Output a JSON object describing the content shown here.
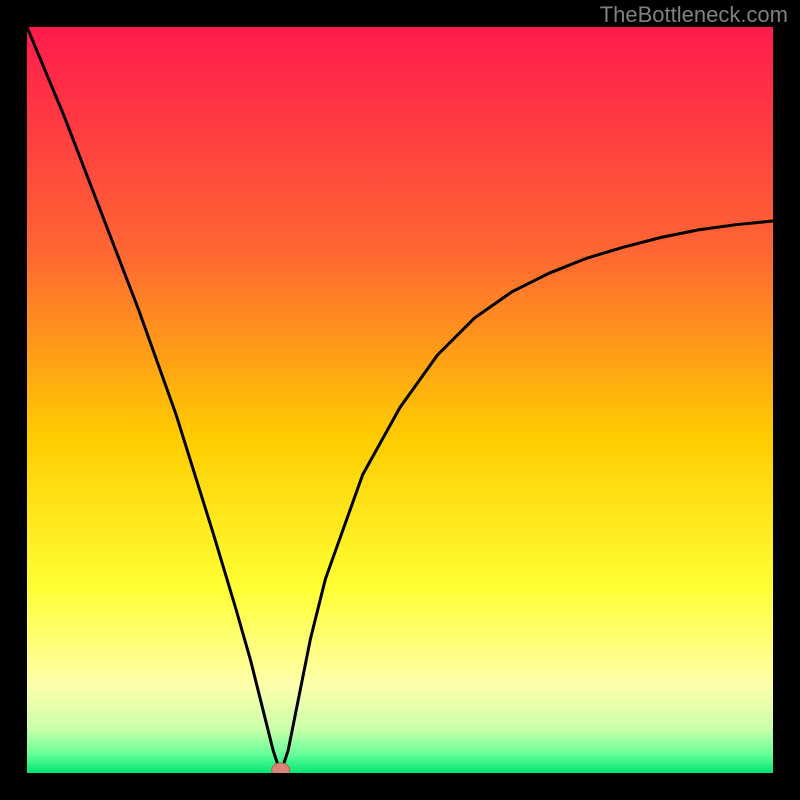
{
  "watermark": "TheBottleneck.com",
  "chart_data": {
    "type": "line",
    "title": "",
    "xlabel": "",
    "ylabel": "",
    "xlim": [
      0,
      100
    ],
    "ylim": [
      0,
      100
    ],
    "minimum_x": 34,
    "marker": {
      "x": 34,
      "y": 0
    },
    "series": [
      {
        "name": "curve",
        "x": [
          0,
          5,
          10,
          15,
          20,
          25,
          28,
          30,
          32,
          33,
          34,
          35,
          36,
          38,
          40,
          45,
          50,
          55,
          60,
          65,
          70,
          75,
          80,
          85,
          90,
          95,
          100
        ],
        "y": [
          100,
          88,
          75,
          62,
          48,
          32,
          22,
          15,
          7,
          3,
          0,
          3,
          8,
          18,
          26,
          40,
          49,
          56,
          61,
          64.5,
          67,
          69,
          70.5,
          71.8,
          72.8,
          73.5,
          74
        ]
      }
    ],
    "gradient_stops": [
      {
        "pos": 0,
        "color": "#ff1a4d"
      },
      {
        "pos": 30,
        "color": "#ff6633"
      },
      {
        "pos": 55,
        "color": "#ffcc00"
      },
      {
        "pos": 75,
        "color": "#ffff33"
      },
      {
        "pos": 88,
        "color": "#ffffaa"
      },
      {
        "pos": 94,
        "color": "#ccffaa"
      },
      {
        "pos": 97.5,
        "color": "#66ff99"
      },
      {
        "pos": 100,
        "color": "#00e673"
      }
    ],
    "colors": {
      "background": "#000000",
      "curve": "#000000",
      "marker_fill": "#d9857a",
      "marker_stroke": "#bf6050"
    }
  }
}
